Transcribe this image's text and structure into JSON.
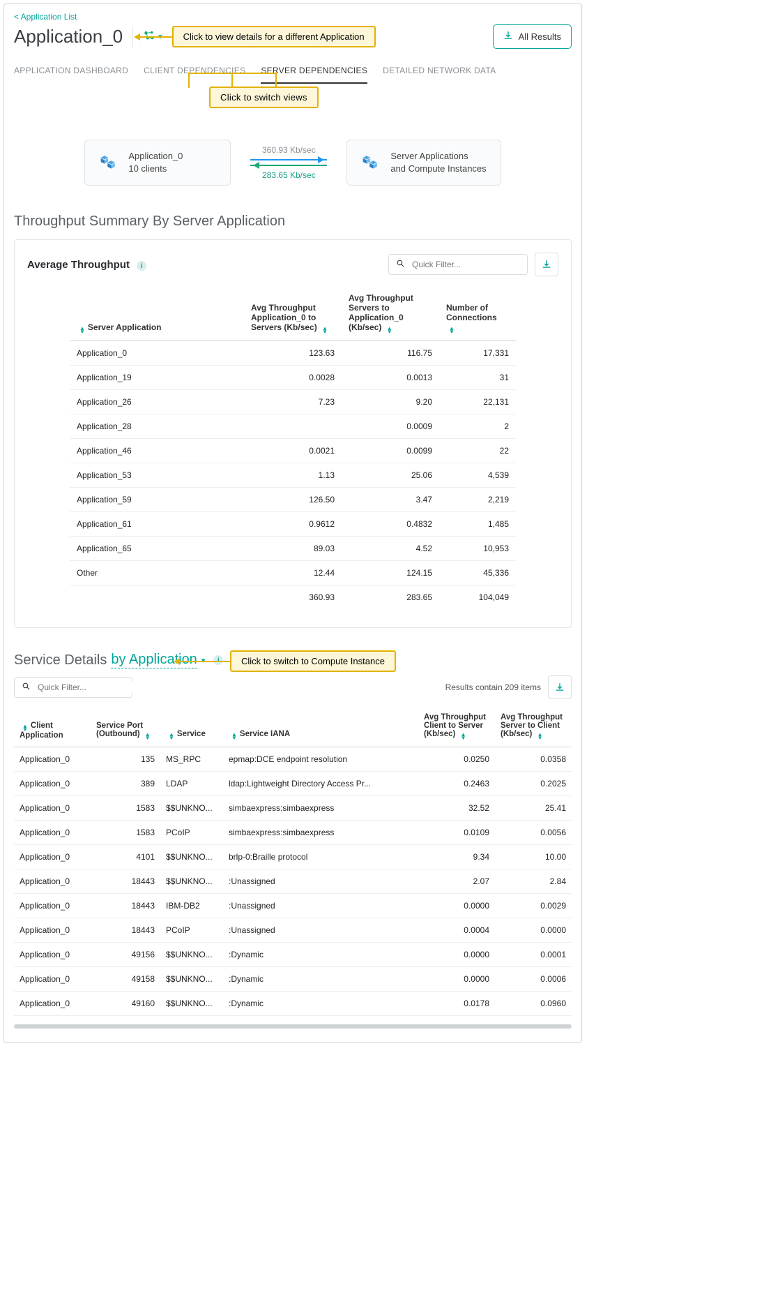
{
  "nav": {
    "back_link": "< Application List"
  },
  "header": {
    "title": "Application_0",
    "all_results_label": "All Results",
    "callout_switch_app": "Click to view details for a different Application"
  },
  "tabs": {
    "items": [
      "APPLICATION DASHBOARD",
      "CLIENT DEPENDENCIES",
      "SERVER DEPENDENCIES",
      "DETAILED NETWORK DATA"
    ],
    "active_index": 2,
    "callout_switch_views": "Click to switch views"
  },
  "flow": {
    "left_name": "Application_0",
    "left_sub": "10 clients",
    "right_line1": "Server Applications",
    "right_line2": "and Compute Instances",
    "rate_out": "360.93 Kb/sec",
    "rate_in": "283.65 Kb/sec"
  },
  "summary": {
    "section_title": "Throughput Summary By Server Application",
    "panel_title": "Average Throughput",
    "filter_placeholder": "Quick Filter...",
    "columns": [
      "Server Application",
      "Avg Throughput Application_0 to Servers (Kb/sec)",
      "Avg Throughput Servers to Application_0 (Kb/sec)",
      "Number of Connections"
    ],
    "rows": [
      {
        "app": "Application_0",
        "out": "123.63",
        "in": "116.75",
        "conn": "17,331"
      },
      {
        "app": "Application_19",
        "out": "0.0028",
        "in": "0.0013",
        "conn": "31"
      },
      {
        "app": "Application_26",
        "out": "7.23",
        "in": "9.20",
        "conn": "22,131"
      },
      {
        "app": "Application_28",
        "out": "",
        "in": "0.0009",
        "conn": "2"
      },
      {
        "app": "Application_46",
        "out": "0.0021",
        "in": "0.0099",
        "conn": "22"
      },
      {
        "app": "Application_53",
        "out": "1.13",
        "in": "25.06",
        "conn": "4,539"
      },
      {
        "app": "Application_59",
        "out": "126.50",
        "in": "3.47",
        "conn": "2,219"
      },
      {
        "app": "Application_61",
        "out": "0.9612",
        "in": "0.4832",
        "conn": "1,485"
      },
      {
        "app": "Application_65",
        "out": "89.03",
        "in": "4.52",
        "conn": "10,953"
      },
      {
        "app": "Other",
        "out": "12.44",
        "in": "124.15",
        "conn": "45,336"
      }
    ],
    "totals": {
      "out": "360.93",
      "in": "283.65",
      "conn": "104,049"
    }
  },
  "details": {
    "section_title_prefix": "Service Details ",
    "section_title_link": "by Application",
    "callout_compute": "Click to switch to Compute Instance",
    "filter_placeholder": "Quick Filter...",
    "results_text": "Results contain 209 items",
    "columns": [
      "Client Application",
      "Service Port (Outbound)",
      "Service",
      "Service IANA",
      "Avg Throughput Client to Server (Kb/sec)",
      "Avg Throughput Server to Client (Kb/sec)"
    ],
    "rows": [
      {
        "client": "Application_0",
        "port": "135",
        "svc": "MS_RPC",
        "iana": "epmap:DCE endpoint resolution",
        "c2s": "0.0250",
        "s2c": "0.0358"
      },
      {
        "client": "Application_0",
        "port": "389",
        "svc": "LDAP",
        "iana": "ldap:Lightweight Directory Access Pr...",
        "c2s": "0.2463",
        "s2c": "0.2025"
      },
      {
        "client": "Application_0",
        "port": "1583",
        "svc": "$$UNKNO...",
        "iana": "simbaexpress:simbaexpress",
        "c2s": "32.52",
        "s2c": "25.41"
      },
      {
        "client": "Application_0",
        "port": "1583",
        "svc": "PCoIP",
        "iana": "simbaexpress:simbaexpress",
        "c2s": "0.0109",
        "s2c": "0.0056"
      },
      {
        "client": "Application_0",
        "port": "4101",
        "svc": "$$UNKNO...",
        "iana": "brlp-0:Braille protocol",
        "c2s": "9.34",
        "s2c": "10.00"
      },
      {
        "client": "Application_0",
        "port": "18443",
        "svc": "$$UNKNO...",
        "iana": ":Unassigned",
        "c2s": "2.07",
        "s2c": "2.84"
      },
      {
        "client": "Application_0",
        "port": "18443",
        "svc": "IBM-DB2",
        "iana": ":Unassigned",
        "c2s": "0.0000",
        "s2c": "0.0029"
      },
      {
        "client": "Application_0",
        "port": "18443",
        "svc": "PCoIP",
        "iana": ":Unassigned",
        "c2s": "0.0004",
        "s2c": "0.0000"
      },
      {
        "client": "Application_0",
        "port": "49156",
        "svc": "$$UNKNO...",
        "iana": ":Dynamic",
        "c2s": "0.0000",
        "s2c": "0.0001"
      },
      {
        "client": "Application_0",
        "port": "49158",
        "svc": "$$UNKNO...",
        "iana": ":Dynamic",
        "c2s": "0.0000",
        "s2c": "0.0006"
      },
      {
        "client": "Application_0",
        "port": "49160",
        "svc": "$$UNKNO...",
        "iana": ":Dynamic",
        "c2s": "0.0178",
        "s2c": "0.0960"
      }
    ]
  }
}
